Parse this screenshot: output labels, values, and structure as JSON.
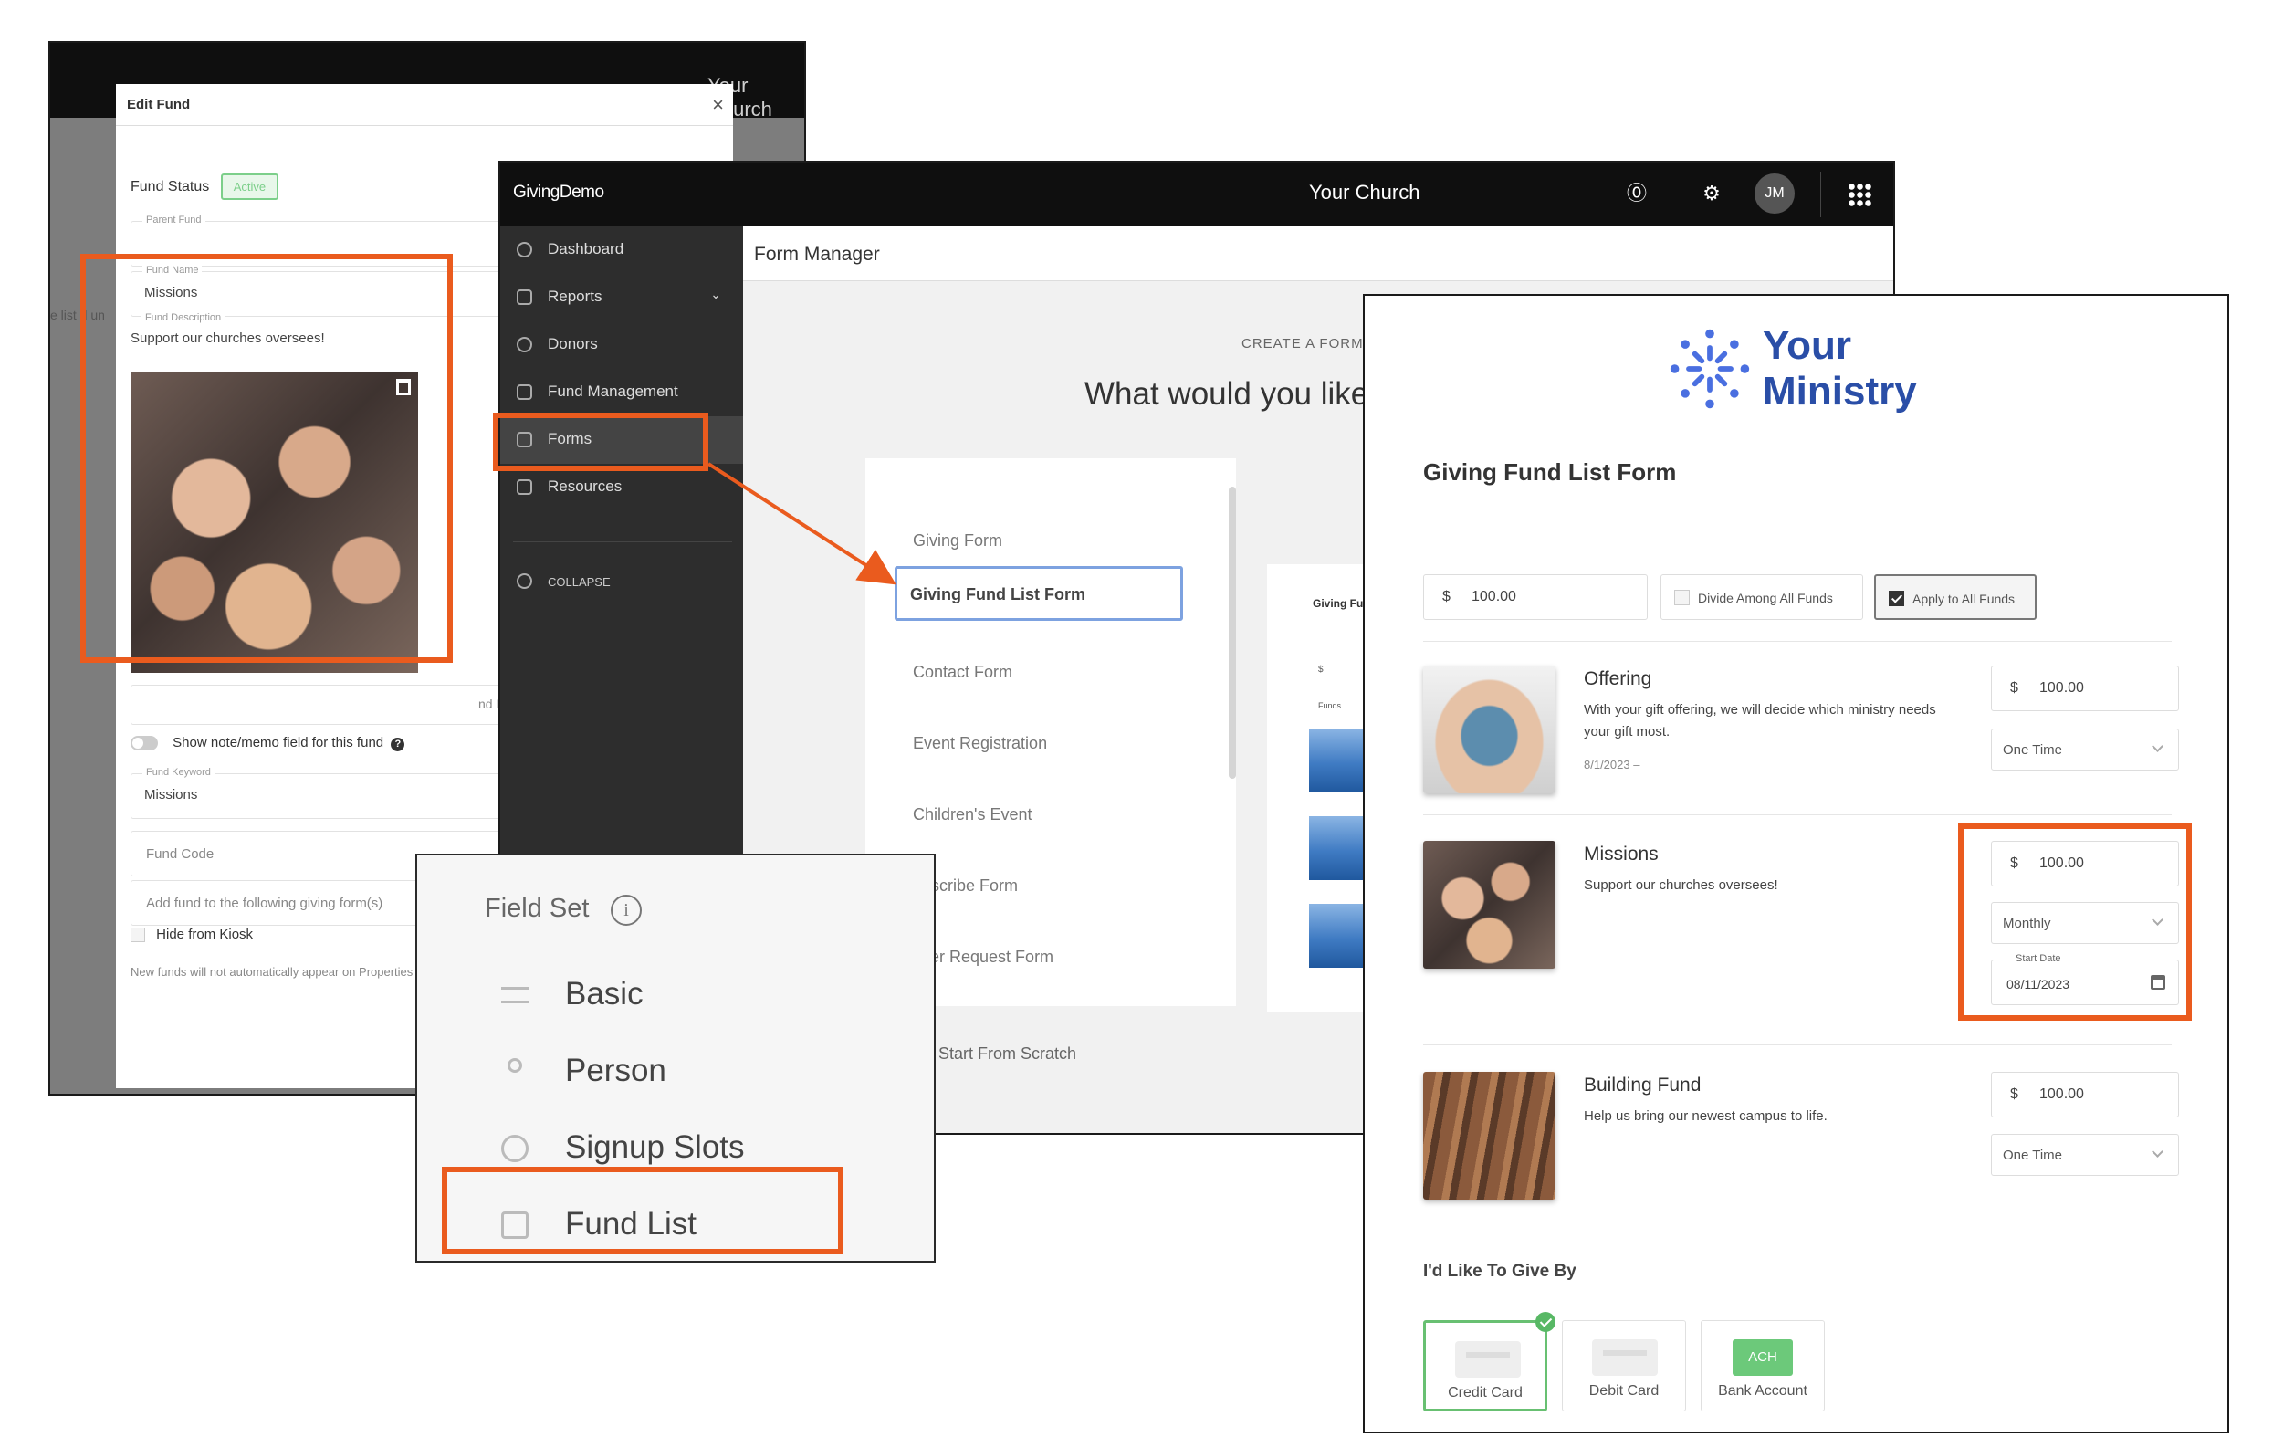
{
  "edit_fund": {
    "church_peek": "Your Church",
    "bg_peek": "e list d un",
    "title": "Edit Fund",
    "close": "×",
    "fund_status_label": "Fund Status",
    "fund_status_value": "Active",
    "parent_fund_label": "Parent Fund",
    "fund_name_label": "Fund Name",
    "fund_name_value": "Missions",
    "fund_description_label": "Fund Description",
    "fund_description_value": "Support our churches oversees!",
    "end_date_peek": "nd Dat",
    "show_note_label": "Show note/memo field for this fund",
    "fund_keyword_label": "Fund Keyword",
    "fund_keyword_value": "Missions",
    "fund_code_placeholder": "Fund Code",
    "add_fund_placeholder": "Add fund to the following giving form(s)",
    "hide_kiosk_label": "Hide from Kiosk",
    "info_text": "New funds will not automatically appear on Properties to add to your form."
  },
  "form_manager": {
    "brand": "GivingDemo",
    "church_title": "Your Church",
    "avatar_initials": "JM",
    "nav": [
      {
        "label": "Dashboard"
      },
      {
        "label": "Reports"
      },
      {
        "label": "Donors"
      },
      {
        "label": "Fund Management"
      },
      {
        "label": "Forms"
      },
      {
        "label": "Resources"
      }
    ],
    "collapse_label": "COLLAPSE",
    "title": "Form Manager",
    "create_label": "CREATE A FORM",
    "question": "What would you like",
    "forms": [
      "Giving Form",
      "Giving Fund List Form",
      "Contact Form",
      "Event Registration",
      "Children's Event",
      "ubscribe Form",
      "ayer Request Form"
    ],
    "start_from_scratch": "Start From Scratch",
    "preview_title": "Giving Fu",
    "preview_field": "$",
    "preview_funds": "Funds"
  },
  "field_set": {
    "title": "Field Set",
    "info_icon": "i",
    "items": [
      "Basic",
      "Person",
      "Signup Slots",
      "Fund List"
    ]
  },
  "giving_form": {
    "logo_line1": "Your",
    "logo_line2": "Ministry",
    "title": "Giving Fund List Form",
    "currency": "$",
    "amount": "100.00",
    "divide_label": "Divide Among All Funds",
    "apply_label": "Apply to All Funds",
    "funds": [
      {
        "name": "Offering",
        "desc": "With your gift offering, we will decide which ministry needs your gift most.",
        "date": "8/1/2023 –",
        "amount": "100.00",
        "frequency": "One Time"
      },
      {
        "name": "Missions",
        "desc": "Support our churches oversees!",
        "amount": "100.00",
        "frequency": "Monthly",
        "start_date_label": "Start Date",
        "start_date": "08/11/2023"
      },
      {
        "name": "Building Fund",
        "desc": "Help us bring our newest campus to life.",
        "amount": "100.00",
        "frequency": "One Time"
      }
    ],
    "give_by_label": "I'd Like To Give By",
    "payment_methods": [
      "Credit Card",
      "Debit Card",
      "Bank Account"
    ],
    "ach_label": "ACH"
  },
  "colors": {
    "highlight": "#ea5b1e",
    "brand_blue": "#2a4ea7",
    "selection_blue": "#7da2e0",
    "success_green": "#68c072"
  }
}
